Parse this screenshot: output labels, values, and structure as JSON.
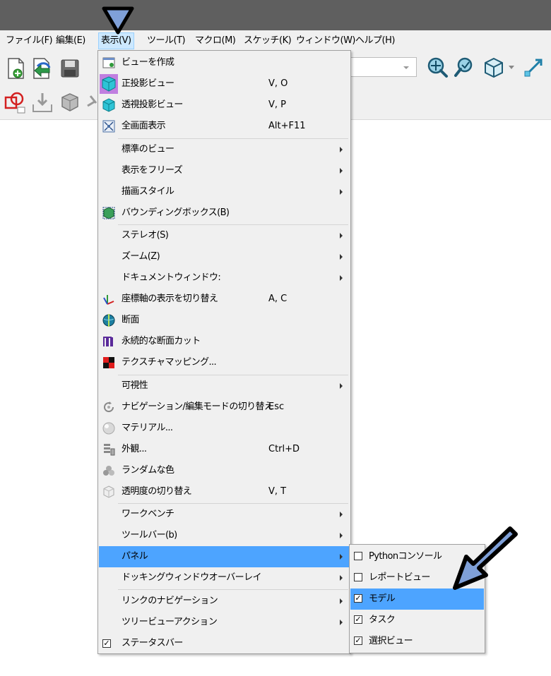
{
  "menubar": {
    "items": [
      {
        "label": "ファイル(F)"
      },
      {
        "label": "編集(E)"
      },
      {
        "label": "表示(V)"
      },
      {
        "label": "ツール(T)"
      },
      {
        "label": "マクロ(M)"
      },
      {
        "label": "スケッチ(K)"
      },
      {
        "label": "ウィンドウ(W)"
      },
      {
        "label": "ヘルプ(H)"
      }
    ]
  },
  "view_menu": {
    "items": [
      {
        "label": "ビューを作成",
        "shortcut": ""
      },
      {
        "label": "正投影ビュー",
        "shortcut": "V, O"
      },
      {
        "label": "透視投影ビュー",
        "shortcut": "V, P"
      },
      {
        "label": "全画面表示",
        "shortcut": "Alt+F11"
      },
      {
        "label": "標準のビュー",
        "shortcut": ""
      },
      {
        "label": "表示をフリーズ",
        "shortcut": ""
      },
      {
        "label": "描画スタイル",
        "shortcut": ""
      },
      {
        "label": "バウンディングボックス(B)",
        "shortcut": ""
      },
      {
        "label": "ステレオ(S)",
        "shortcut": ""
      },
      {
        "label": "ズーム(Z)",
        "shortcut": ""
      },
      {
        "label": "ドキュメントウィンドウ:",
        "shortcut": ""
      },
      {
        "label": "座標軸の表示を切り替え",
        "shortcut": "A, C"
      },
      {
        "label": "断面",
        "shortcut": ""
      },
      {
        "label": "永続的な断面カット",
        "shortcut": ""
      },
      {
        "label": "テクスチャマッピング...",
        "shortcut": ""
      },
      {
        "label": "可視性",
        "shortcut": ""
      },
      {
        "label": "ナビゲーション/編集モードの切り替え",
        "shortcut": "Esc"
      },
      {
        "label": "マテリアル...",
        "shortcut": ""
      },
      {
        "label": "外観...",
        "shortcut": "Ctrl+D"
      },
      {
        "label": "ランダムな色",
        "shortcut": ""
      },
      {
        "label": "透明度の切り替え",
        "shortcut": "V, T"
      },
      {
        "label": "ワークベンチ",
        "shortcut": ""
      },
      {
        "label": "ツールバー(b)",
        "shortcut": ""
      },
      {
        "label": "パネル",
        "shortcut": ""
      },
      {
        "label": "ドッキングウィンドウオーバーレイ",
        "shortcut": ""
      },
      {
        "label": "リンクのナビゲーション",
        "shortcut": ""
      },
      {
        "label": "ツリービューアクション",
        "shortcut": ""
      },
      {
        "label": "ステータスバー",
        "shortcut": ""
      }
    ]
  },
  "panel_submenu": {
    "items": [
      {
        "label": "Pythonコンソール",
        "checked": false
      },
      {
        "label": "レポートビュー",
        "checked": false
      },
      {
        "label": "モデル",
        "checked": true
      },
      {
        "label": "タスク",
        "checked": true
      },
      {
        "label": "選択ビュー",
        "checked": true
      }
    ]
  },
  "colors": {
    "highlight": "#4da4ff",
    "menu_bg": "#f0f0f0",
    "titlebar": "#5f5f5f",
    "annotation_arrow": "#7fa0d8"
  }
}
